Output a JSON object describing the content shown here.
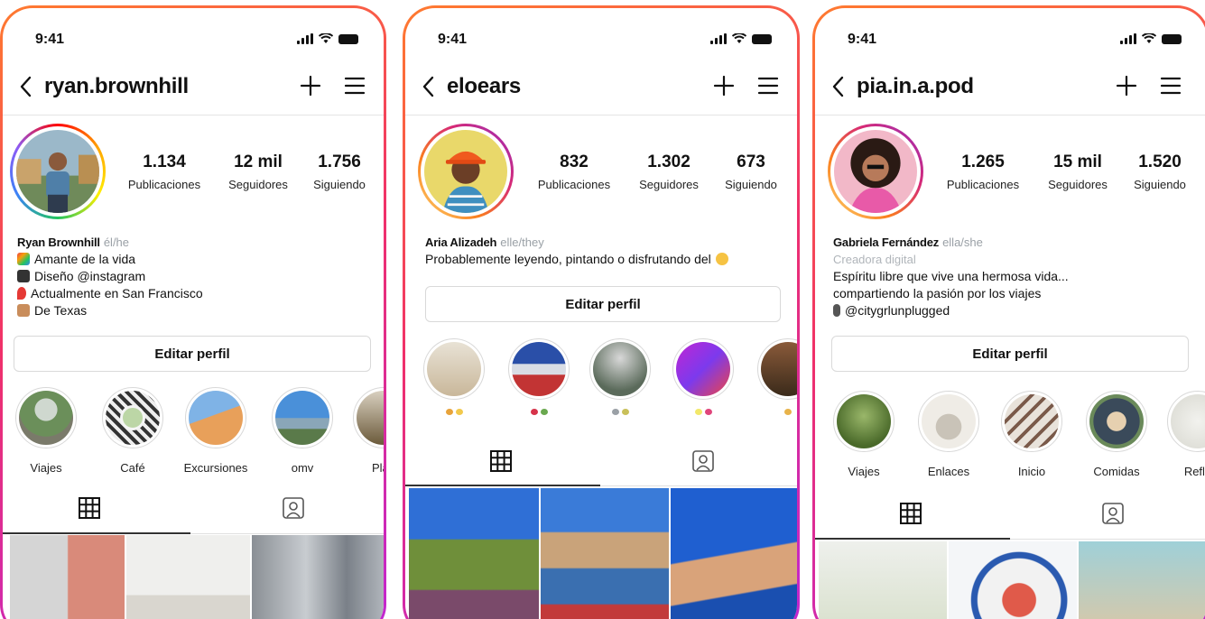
{
  "profiles": [
    {
      "time": "9:41",
      "username": "ryan.brownhill",
      "stats": [
        {
          "value": "1.134",
          "label": "Publicaciones"
        },
        {
          "value": "12 mil",
          "label": "Seguidores"
        },
        {
          "value": "1.756",
          "label": "Siguiendo"
        }
      ],
      "bio": {
        "name": "Ryan Brownhill",
        "pronouns": "él/he",
        "lines": [
          "Amante de la vida",
          "Diseño @instagram",
          "Actualmente en San Francisco",
          "De Texas"
        ]
      },
      "edit_button": "Editar perfil",
      "highlights": [
        "Viajes",
        "Café",
        "Excursiones",
        "omv",
        "Plan"
      ]
    },
    {
      "time": "9:41",
      "username": "eloears",
      "stats": [
        {
          "value": "832",
          "label": "Publicaciones"
        },
        {
          "value": "1.302",
          "label": "Seguidores"
        },
        {
          "value": "673",
          "label": "Siguiendo"
        }
      ],
      "bio": {
        "name": "Aria Alizadeh",
        "pronouns": "elle/they",
        "lines": [
          "Probablemente leyendo, pintando o disfrutando del"
        ]
      },
      "edit_button": "Editar perfil",
      "highlights": [
        "",
        "",
        "",
        "",
        ""
      ]
    },
    {
      "time": "9:41",
      "username": "pia.in.a.pod",
      "stats": [
        {
          "value": "1.265",
          "label": "Publicaciones"
        },
        {
          "value": "15 mil",
          "label": "Seguidores"
        },
        {
          "value": "1.520",
          "label": "Siguiendo"
        }
      ],
      "bio": {
        "name": "Gabriela Fernández",
        "pronouns": "ella/she",
        "category": "Creadora digital",
        "lines": [
          "Espíritu libre que vive una hermosa vida...",
          "compartiendo la pasión por los viajes",
          "@citygrlunplugged"
        ]
      },
      "edit_button": "Editar perfil",
      "highlights": [
        "Viajes",
        "Enlaces",
        "Inicio",
        "Comidas",
        "Refle"
      ]
    }
  ],
  "icons": [
    "back-icon",
    "plus-icon",
    "menu-icon",
    "grid-icon",
    "tagged-icon",
    "signal-icon",
    "wifi-icon",
    "battery-icon"
  ],
  "colors": {
    "frame_gradient": [
      "#ff7a2f",
      "#f0306a",
      "#c026d3"
    ],
    "pronoun_gray": "#9aa0a6"
  }
}
